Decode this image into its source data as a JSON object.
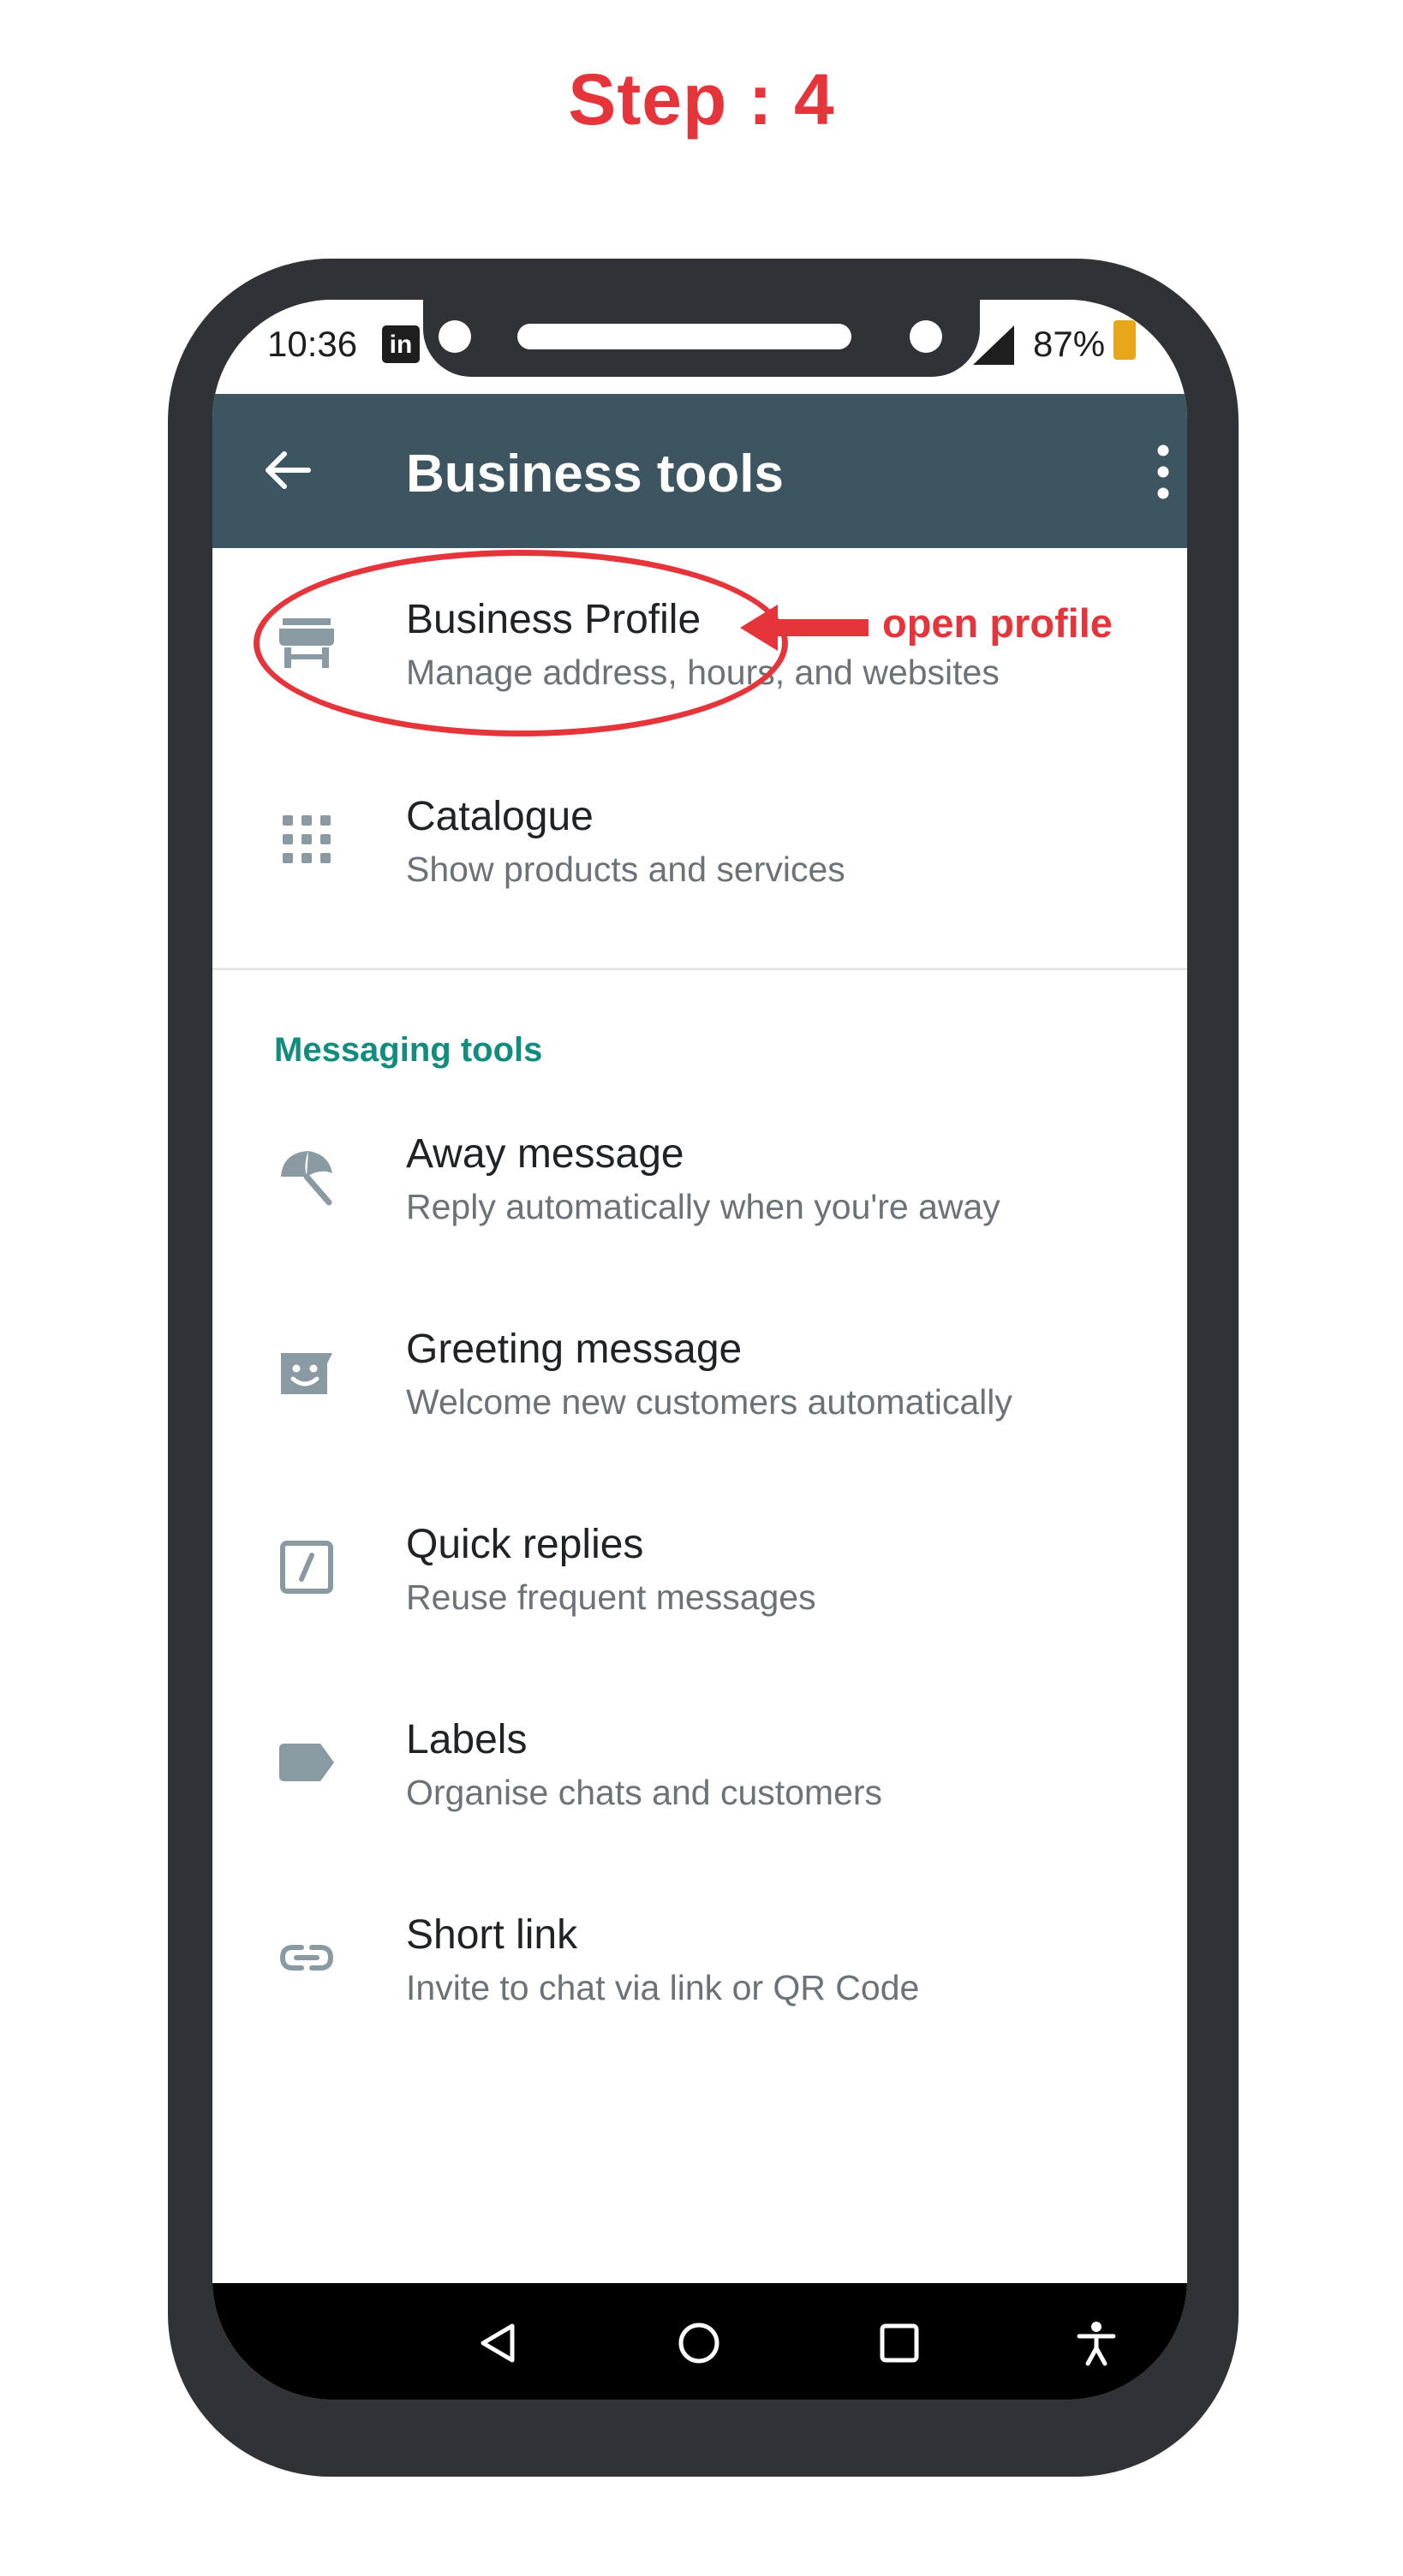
{
  "step_label": "Step : 4",
  "status_bar": {
    "time": "10:36",
    "app_icon": "linkedin-icon",
    "app_icon_text": "in",
    "battery": "87%"
  },
  "app_bar": {
    "title": "Business tools",
    "back_icon": "arrow-back-icon",
    "menu_icon": "more-vert-icon",
    "color": "#3d5560"
  },
  "business_items": [
    {
      "title": "Business Profile",
      "subtitle": "Manage address, hours, and websites",
      "icon": "storefront-icon"
    },
    {
      "title": "Catalogue",
      "subtitle": "Show products and services",
      "icon": "grid-dots-icon"
    }
  ],
  "messaging_section": {
    "header": "Messaging tools",
    "header_color": "#128c7e",
    "items": [
      {
        "title": "Away message",
        "subtitle": "Reply automatically when you're away",
        "icon": "beach-umbrella-icon"
      },
      {
        "title": "Greeting message",
        "subtitle": "Welcome new customers automatically",
        "icon": "greeting-face-icon"
      },
      {
        "title": "Quick replies",
        "subtitle": "Reuse frequent messages",
        "icon": "quick-reply-icon"
      },
      {
        "title": "Labels",
        "subtitle": "Organise chats and customers",
        "icon": "label-icon"
      },
      {
        "title": "Short link",
        "subtitle": "Invite to chat via link or QR Code",
        "icon": "link-icon"
      }
    ]
  },
  "nav_bar": [
    "back-triangle-icon",
    "home-circle-icon",
    "recents-square-icon",
    "accessibility-icon"
  ],
  "annotation": {
    "label": "open profile",
    "color": "#e6343b"
  }
}
